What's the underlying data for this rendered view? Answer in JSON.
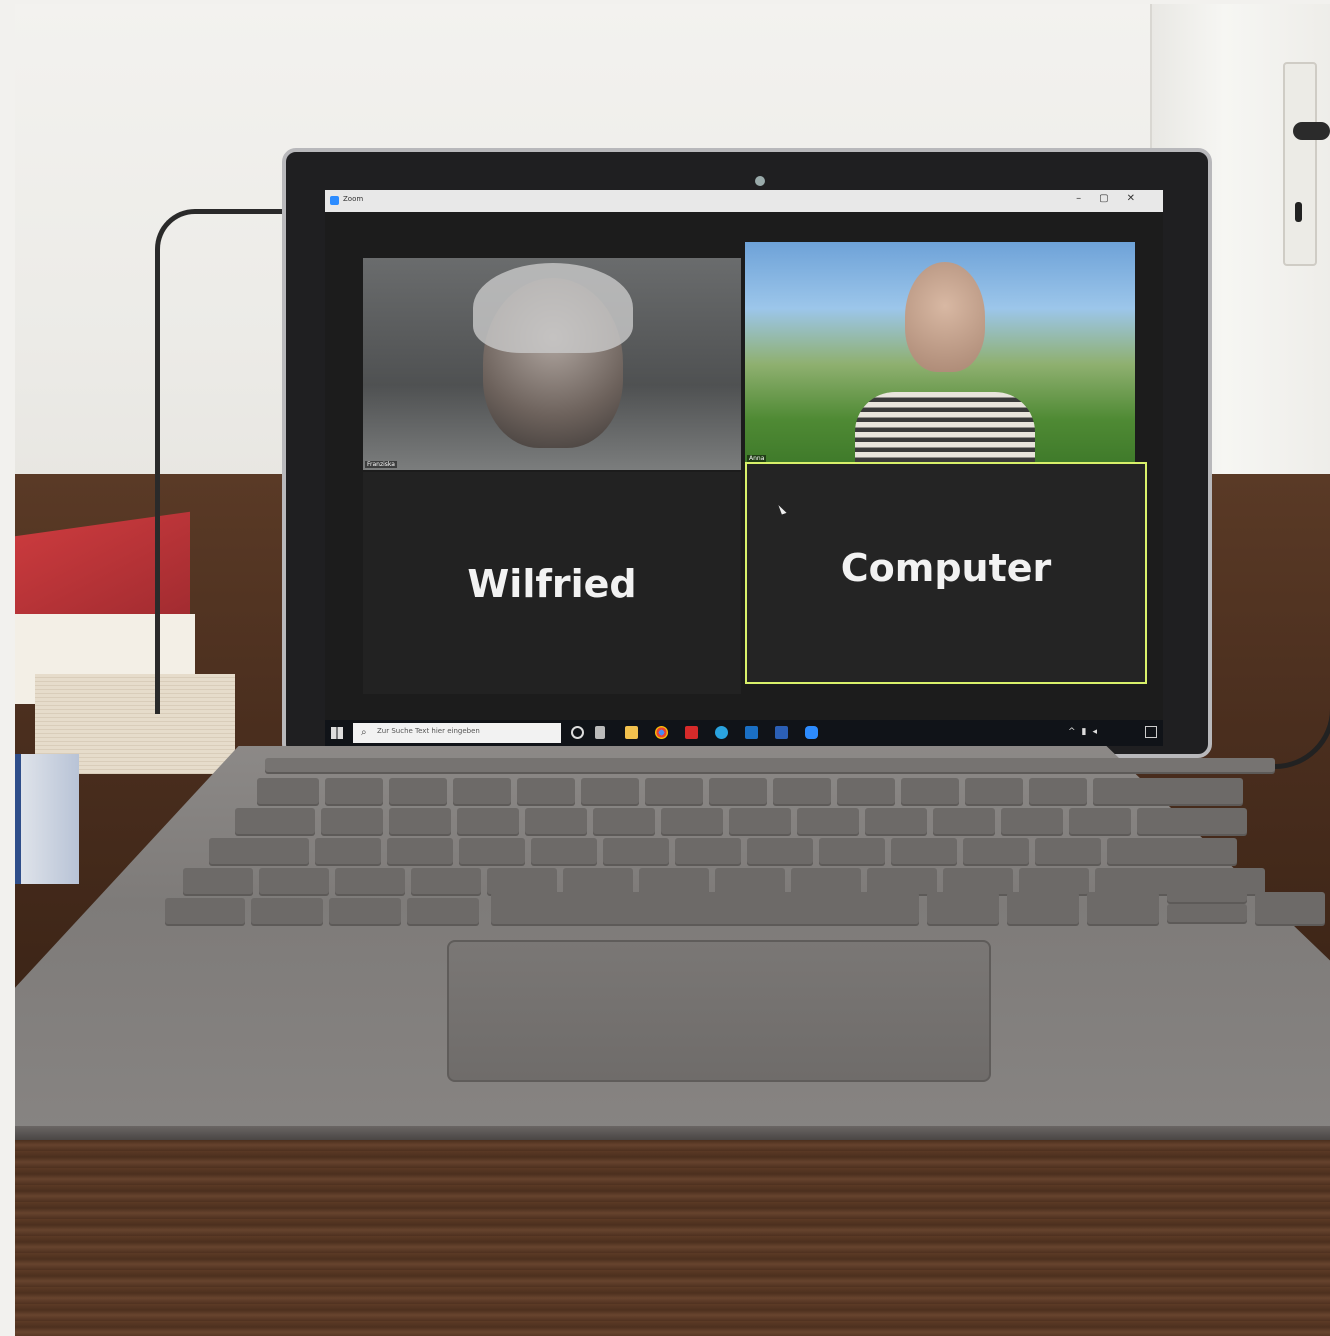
{
  "zoom_window": {
    "app_title": "Zoom",
    "participants": [
      {
        "name_label": "Franziska",
        "video": true
      },
      {
        "name_label": "Anna",
        "video": true
      },
      {
        "display_name": "Wilfried",
        "video": false
      },
      {
        "display_name": "Computer",
        "video": false,
        "active_speaker": true
      }
    ]
  },
  "taskbar": {
    "search_placeholder": "Zur Suche Text hier eingeben"
  },
  "colors": {
    "active_speaker_border": "#d8f06a",
    "zoom_blue": "#2d8cff",
    "taskbar": "#101318"
  }
}
